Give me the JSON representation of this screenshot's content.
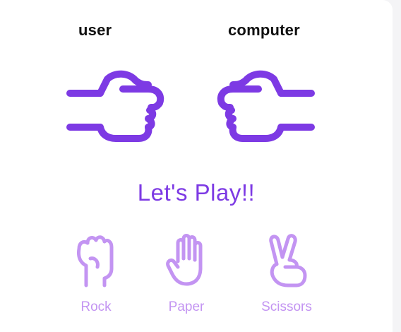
{
  "players": {
    "user_label": "user",
    "computer_label": "computer",
    "user_hand_icon": "fist-pointing-right-icon",
    "computer_hand_icon": "fist-pointing-left-icon"
  },
  "game": {
    "status": "Let's Play!!"
  },
  "choices": [
    {
      "label": "Rock",
      "icon": "rock-hand-icon"
    },
    {
      "label": "Paper",
      "icon": "paper-hand-icon"
    },
    {
      "label": "Scissors",
      "icon": "scissors-hand-icon"
    }
  ],
  "colors": {
    "accent": "#7d3ae4",
    "choice": "#c394f2",
    "label": "#111111",
    "background": "#ffffff"
  }
}
